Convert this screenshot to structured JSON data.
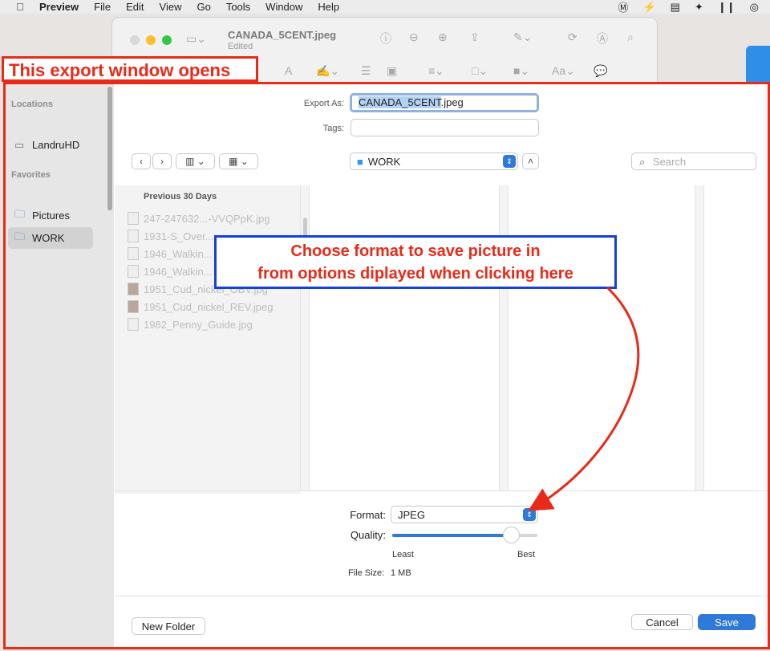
{
  "menubar": {
    "app": "Preview",
    "items": [
      "File",
      "Edit",
      "View",
      "Go",
      "Tools",
      "Window",
      "Help"
    ],
    "status_icons": [
      "malwarebytes-icon",
      "bolt-icon",
      "clipboard-icon",
      "dropbox-icon",
      "pause-icon",
      "airdrop-icon"
    ]
  },
  "preview_window": {
    "title": "CANADA_5CENT.jpeg",
    "subtitle": "Edited",
    "toolbar_text": "Aa"
  },
  "annotations": {
    "export_window": "This export window opens",
    "format_line1": "Choose format to save picture in",
    "format_line2": "from options diplayed when clicking here"
  },
  "sidebar": {
    "locations_header": "Locations",
    "drive": "LandruHD",
    "favorites_header": "Favorites",
    "items": [
      {
        "label": "Pictures"
      },
      {
        "label": "WORK",
        "selected": true
      }
    ]
  },
  "export": {
    "export_as_label": "Export As:",
    "filename_base": "CANADA_5CENT",
    "filename_ext": ".jpeg",
    "tags_label": "Tags:",
    "location": "WORK",
    "search_placeholder": "Search"
  },
  "file_list": {
    "header": "Previous 30 Days",
    "files": [
      "247-247632...-VVQPpK.jpg",
      "1931-S_Over...",
      "1946_Walkin...",
      "1946_Walkin...",
      "1951_Cud_nickel_OBV.jpg",
      "1951_Cud_nickel_REV.jpeg",
      "1982_Penny_Guide.jpg"
    ]
  },
  "options": {
    "format_label": "Format:",
    "format_value": "JPEG",
    "quality_label": "Quality:",
    "quality_value": 0.82,
    "least_label": "Least",
    "best_label": "Best",
    "filesize_label": "File Size:",
    "filesize_value": "1 MB"
  },
  "buttons": {
    "new_folder": "New Folder",
    "cancel": "Cancel",
    "save": "Save"
  },
  "colors": {
    "annotation_red": "#e82a19",
    "annotation_blue": "#1540d8",
    "accent": "#2f7ad9"
  }
}
